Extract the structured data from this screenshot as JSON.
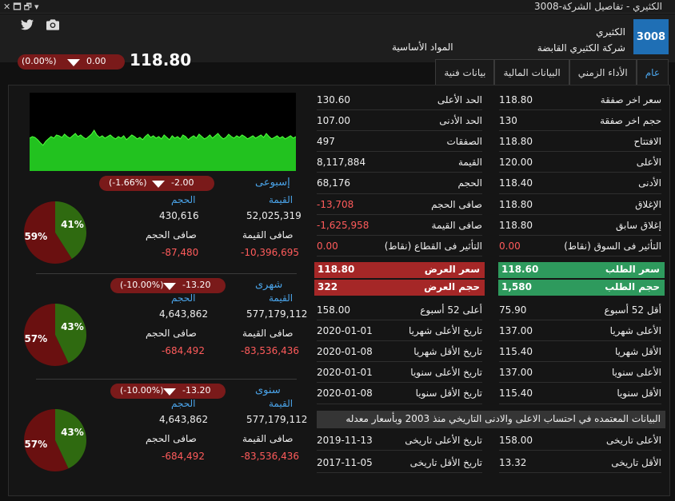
{
  "window": {
    "title": "3008-الكثيري - تفاصيل الشركة",
    "controls": [
      "✕",
      "🗖",
      "🗗",
      "▾"
    ]
  },
  "header": {
    "code": "3008",
    "name": "الكثيري",
    "full_name": "شركة الكثيري القابضة",
    "sector": "المواد الأساسية",
    "last_price": "118.80",
    "change": "0.00",
    "change_pct": "(0.00%)"
  },
  "tabs": [
    {
      "label": "عام",
      "active": true
    },
    {
      "label": "الأداء الزمني",
      "active": false
    },
    {
      "label": "البيانات المالية",
      "active": false
    },
    {
      "label": "بيانات فنية",
      "active": false
    }
  ],
  "col1": [
    {
      "label": "سعر اخر صفقة",
      "value": "118.80"
    },
    {
      "label": "حجم اخر صفقة",
      "value": "130"
    },
    {
      "label": "الافتتاح",
      "value": "118.80"
    },
    {
      "label": "الأعلى",
      "value": "120.00"
    },
    {
      "label": "الأدنى",
      "value": "118.40"
    },
    {
      "label": "الإغلاق",
      "value": "118.80"
    },
    {
      "label": "إغلاق سابق",
      "value": "118.80"
    },
    {
      "label": "التأثير فى السوق (نقاط)",
      "value": "0.00",
      "neg": true
    }
  ],
  "col2": [
    {
      "label": "الحد الأعلى",
      "value": "130.60"
    },
    {
      "label": "الحد الأدنى",
      "value": "107.00"
    },
    {
      "label": "الصفقات",
      "value": "497"
    },
    {
      "label": "القيمة",
      "value": "8,117,884"
    },
    {
      "label": "الحجم",
      "value": "68,176"
    },
    {
      "label": "صافى الحجم",
      "value": "-13,708",
      "neg": true
    },
    {
      "label": "صافى القيمة",
      "value": "-1,625,958",
      "neg": true
    },
    {
      "label": "التأثير فى القطاع (نقاط)",
      "value": "0.00",
      "neg": true
    }
  ],
  "bid": [
    {
      "label": "سعر الطلب",
      "value": "118.60"
    },
    {
      "label": "حجم الطلب",
      "value": "1,580"
    }
  ],
  "ask": [
    {
      "label": "سعر العرض",
      "value": "118.80"
    },
    {
      "label": "حجم العرض",
      "value": "322"
    }
  ],
  "col1b": [
    {
      "label": "أقل 52 أسبوع",
      "value": "75.90"
    },
    {
      "label": "الأعلى شهريا",
      "value": "137.00"
    },
    {
      "label": "الأقل شهريا",
      "value": "115.40"
    },
    {
      "label": "الأعلى سنويا",
      "value": "137.00"
    },
    {
      "label": "الأقل سنويا",
      "value": "115.40"
    }
  ],
  "col2b": [
    {
      "label": "أعلى 52 أسبوع",
      "value": "158.00"
    },
    {
      "label": "تاريخ الأعلى شهريا",
      "value": "2020-01-01"
    },
    {
      "label": "تاريخ الأقل شهريا",
      "value": "2020-01-08"
    },
    {
      "label": "تاريخ الأعلى سنويا",
      "value": "2020-01-01"
    },
    {
      "label": "تاريخ الأقل سنويا",
      "value": "2020-01-08"
    }
  ],
  "notice": "البيانات المعتمده في احتساب الاعلى والادنى التاريخي منذ  2003  وبأسعار معدله",
  "historic": {
    "col1": [
      {
        "label": "الأعلى تاريخى",
        "value": "158.00"
      },
      {
        "label": "الأقل تاريخى",
        "value": "13.32"
      }
    ],
    "col2": [
      {
        "label": "تاريخ الأعلى تاريخى",
        "value": "2019-11-13"
      },
      {
        "label": "تاريخ الأقل تاريخى",
        "value": "2017-11-05"
      }
    ]
  },
  "periods": [
    {
      "name": "إسبوعى",
      "change": "-2.00",
      "change_pct": "(-1.66%)",
      "value_label": "القيمة",
      "value": "52,025,319",
      "volume_label": "الحجم",
      "volume": "430,616",
      "net_value_label": "صافى القيمة",
      "net_value": "-10,396,695",
      "net_volume_label": "صافى الحجم",
      "net_volume": "-87,480",
      "pie": {
        "green_pct": 41,
        "red_pct": 59,
        "green_label": "41%",
        "red_label": "59%"
      }
    },
    {
      "name": "شهرى",
      "change": "-13.20",
      "change_pct": "(-10.00%)",
      "value_label": "القيمة",
      "value": "577,179,112",
      "volume_label": "الحجم",
      "volume": "4,643,862",
      "net_value_label": "صافى القيمة",
      "net_value": "-83,536,436",
      "net_volume_label": "صافى الحجم",
      "net_volume": "-684,492",
      "pie": {
        "green_pct": 43,
        "red_pct": 57,
        "green_label": "43%",
        "red_label": "57%"
      }
    },
    {
      "name": "سنوى",
      "change": "-13.20",
      "change_pct": "(-10.00%)",
      "value_label": "القيمة",
      "value": "577,179,112",
      "volume_label": "الحجم",
      "volume": "4,643,862",
      "net_value_label": "صافى القيمة",
      "net_value": "-83,536,436",
      "net_volume_label": "صافى الحجم",
      "net_volume": "-684,492",
      "pie": {
        "green_pct": 43,
        "red_pct": 57,
        "green_label": "43%",
        "red_label": "57%"
      }
    }
  ],
  "colors": {
    "accent": "#1f6fb5",
    "green": "#2e9a5d",
    "red": "#a52727",
    "pie_green": "#2f6a10",
    "pie_red": "#6a1010",
    "chart": "#22c21f"
  },
  "chart_data": {
    "type": "area",
    "values": [
      42,
      44,
      43,
      40,
      36,
      33,
      38,
      41,
      44,
      42,
      46,
      45,
      43,
      47,
      44,
      42,
      45,
      48,
      44,
      46,
      43,
      41,
      44,
      47,
      52,
      46,
      43,
      45,
      42,
      44,
      46,
      43,
      41,
      44,
      42,
      45,
      40,
      43,
      46,
      44,
      41,
      43,
      40,
      44,
      47,
      43,
      45,
      42,
      44,
      41,
      46,
      43,
      40,
      45,
      42,
      44,
      41,
      46,
      44,
      40,
      43,
      45,
      42,
      47,
      44,
      41,
      43,
      46,
      42,
      45,
      48,
      44,
      41,
      43,
      47,
      44,
      42,
      45,
      43,
      46,
      44,
      41,
      43,
      45,
      42,
      44,
      46,
      43,
      48,
      44,
      41,
      43,
      45,
      42,
      44,
      41,
      43,
      45,
      42,
      44
    ],
    "ylim": [
      0,
      100
    ]
  }
}
